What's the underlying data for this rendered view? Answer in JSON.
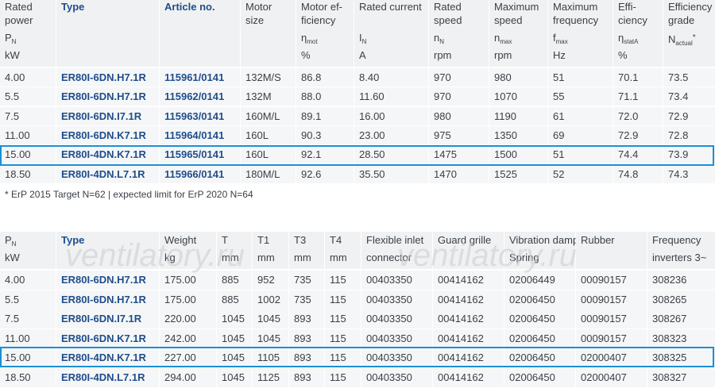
{
  "table1": {
    "headers": [
      {
        "l1": "Rated",
        "l2": "power",
        "sym": "P",
        "sub": "N",
        "unit": "kW"
      },
      {
        "l1": "Type",
        "l2": "",
        "sym": "",
        "sub": "",
        "unit": ""
      },
      {
        "l1": "Article no.",
        "l2": "",
        "sym": "",
        "sub": "",
        "unit": ""
      },
      {
        "l1": "Motor",
        "l2": "size",
        "sym": "",
        "sub": "",
        "unit": ""
      },
      {
        "l1": "Motor ef-",
        "l2": "ficiency",
        "sym": "η",
        "sub": "mot",
        "unit": "%"
      },
      {
        "l1": "Rated current",
        "l2": "",
        "sym": "I",
        "sub": "N",
        "unit": "A"
      },
      {
        "l1": "Rated",
        "l2": "speed",
        "sym": "n",
        "sub": "N",
        "unit": "rpm"
      },
      {
        "l1": "Maximum",
        "l2": "speed",
        "sym": "n",
        "sub": "max",
        "unit": "rpm"
      },
      {
        "l1": "Maximum",
        "l2": "frequency",
        "sym": "f",
        "sub": "max",
        "unit": "Hz"
      },
      {
        "l1": "Effi-",
        "l2": "ciency",
        "sym": "η",
        "sub": "statA",
        "unit": "%"
      },
      {
        "l1": "Efficiency",
        "l2": "grade",
        "sym": "N",
        "sub": "actual",
        "unit": "*"
      }
    ],
    "rows": [
      {
        "power": "4.00",
        "type": "ER80I-6DN.H7.1R",
        "article_main": "115961",
        "article_suffix": "/0141",
        "motor": "132M/S",
        "eff_mot": "86.8",
        "current": "8.40",
        "speed": "970",
        "max_speed": "980",
        "max_freq": "51",
        "eff": "70.1",
        "grade": "73.5"
      },
      {
        "power": "5.5",
        "type": "ER80I-6DN.H7.1R",
        "article_main": "115962",
        "article_suffix": "/0141",
        "motor": "132M",
        "eff_mot": "88.0",
        "current": "11.60",
        "speed": "970",
        "max_speed": "1070",
        "max_freq": "55",
        "eff": "71.1",
        "grade": "73.4"
      },
      {
        "power": "7.5",
        "type": "ER80I-6DN.I7.1R",
        "article_main": "115963",
        "article_suffix": "/0141",
        "motor": "160M/L",
        "eff_mot": "89.1",
        "current": "16.00",
        "speed": "980",
        "max_speed": "1190",
        "max_freq": "61",
        "eff": "72.0",
        "grade": "72.9"
      },
      {
        "power": "11.00",
        "type": "ER80I-6DN.K7.1R",
        "article_main": "115964",
        "article_suffix": "/0141",
        "motor": "160L",
        "eff_mot": "90.3",
        "current": "23.00",
        "speed": "975",
        "max_speed": "1350",
        "max_freq": "69",
        "eff": "72.9",
        "grade": "72.8"
      },
      {
        "power": "15.00",
        "type": "ER80I-4DN.K7.1R",
        "article_main": "115965",
        "article_suffix": "/0141",
        "motor": "160L",
        "eff_mot": "92.1",
        "current": "28.50",
        "speed": "1475",
        "max_speed": "1500",
        "max_freq": "51",
        "eff": "74.4",
        "grade": "73.9"
      },
      {
        "power": "18.50",
        "type": "ER80I-4DN.L7.1R",
        "article_main": "115966",
        "article_suffix": "/0141",
        "motor": "180M/L",
        "eff_mot": "92.6",
        "current": "35.50",
        "speed": "1470",
        "max_speed": "1525",
        "max_freq": "52",
        "eff": "74.8",
        "grade": "74.3"
      }
    ],
    "footnote": "* ErP 2015 Target N=62 | expected limit for ErP 2020 N=64"
  },
  "table2": {
    "headers": [
      {
        "l1": "P",
        "sub": "N",
        "l2": "kW"
      },
      {
        "l1": "Type",
        "sub": "",
        "l2": ""
      },
      {
        "l1": "Weight",
        "sub": "",
        "l2": "kg"
      },
      {
        "l1": "T",
        "sub": "",
        "l2": "mm"
      },
      {
        "l1": "T1",
        "sub": "",
        "l2": "mm"
      },
      {
        "l1": "T3",
        "sub": "",
        "l2": "mm"
      },
      {
        "l1": "T4",
        "sub": "",
        "l2": "mm"
      },
      {
        "l1": "Flexible inlet",
        "sub": "",
        "l2": "connector"
      },
      {
        "l1": "Guard grille",
        "sub": "",
        "l2": ""
      },
      {
        "l1": "Vibration damper",
        "sub": "",
        "l2": "Spring"
      },
      {
        "l1": "",
        "sub": "",
        "l2": "Rubber"
      },
      {
        "l1": "Frequency",
        "sub": "",
        "l2": "inverters 3~"
      }
    ],
    "rows": [
      {
        "power": "4.00",
        "type": "ER80I-6DN.H7.1R",
        "weight": "175.00",
        "t": "885",
        "t1": "952",
        "t3": "735",
        "t4": "115",
        "inlet": "00403350",
        "grille": "00414162",
        "spring": "02006449",
        "rubber": "00090157",
        "inverter": "308236"
      },
      {
        "power": "5.5",
        "type": "ER80I-6DN.H7.1R",
        "weight": "175.00",
        "t": "885",
        "t1": "1002",
        "t3": "735",
        "t4": "115",
        "inlet": "00403350",
        "grille": "00414162",
        "spring": "02006450",
        "rubber": "00090157",
        "inverter": "308265"
      },
      {
        "power": "7.5",
        "type": "ER80I-6DN.I7.1R",
        "weight": "220.00",
        "t": "1045",
        "t1": "1045",
        "t3": "893",
        "t4": "115",
        "inlet": "00403350",
        "grille": "00414162",
        "spring": "02006450",
        "rubber": "00090157",
        "inverter": "308267"
      },
      {
        "power": "11.00",
        "type": "ER80I-6DN.K7.1R",
        "weight": "242.00",
        "t": "1045",
        "t1": "1045",
        "t3": "893",
        "t4": "115",
        "inlet": "00403350",
        "grille": "00414162",
        "spring": "02006450",
        "rubber": "00090157",
        "inverter": "308323"
      },
      {
        "power": "15.00",
        "type": "ER80I-4DN.K7.1R",
        "weight": "227.00",
        "t": "1045",
        "t1": "1105",
        "t3": "893",
        "t4": "115",
        "inlet": "00403350",
        "grille": "00414162",
        "spring": "02006450",
        "rubber": "02000407",
        "inverter": "308325"
      },
      {
        "power": "18.50",
        "type": "ER80I-4DN.L7.1R",
        "weight": "294.00",
        "t": "1045",
        "t1": "1125",
        "t3": "893",
        "t4": "115",
        "inlet": "00403350",
        "grille": "00414162",
        "spring": "02006450",
        "rubber": "02000407",
        "inverter": "308327"
      }
    ]
  },
  "watermark": {
    "text": "ventilatory.ru"
  },
  "colors": {
    "type_blue": "#1f4e8c",
    "highlight": "#1a8fd6",
    "header_bg": "#f0f1f2",
    "row_bg": "#f5f6f7"
  }
}
